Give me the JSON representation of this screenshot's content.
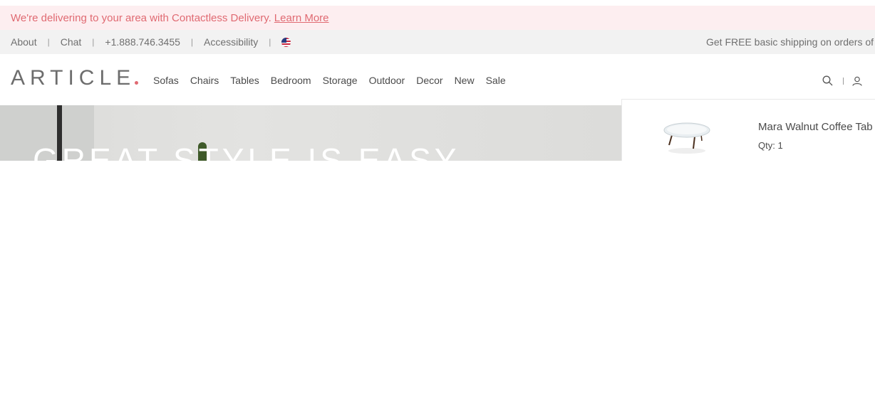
{
  "alert": {
    "message": "We're delivering to your area with Contactless Delivery.",
    "link_label": "Learn More",
    "color": "#e06a72",
    "background": "#fdeef0"
  },
  "utility": {
    "links": [
      "About",
      "Chat",
      "+1.888.746.3455",
      "Accessibility"
    ],
    "separator": "|",
    "flag_icon": "us-flag-icon",
    "promo": "Get FREE basic shipping on orders of $"
  },
  "nav": {
    "logo": "ARTICLE",
    "logo_dot_color": "#e06a72",
    "items": [
      "Sofas",
      "Chairs",
      "Tables",
      "Bedroom",
      "Storage",
      "Outdoor",
      "Decor",
      "New",
      "Sale"
    ],
    "search_icon": "search-icon",
    "account_icon": "user-icon"
  },
  "hero": {
    "heading": "GREAT STYLE IS EASY"
  },
  "cart": {
    "item_name": "Mara Walnut Coffee Tab",
    "qty": "Qty: 1"
  }
}
